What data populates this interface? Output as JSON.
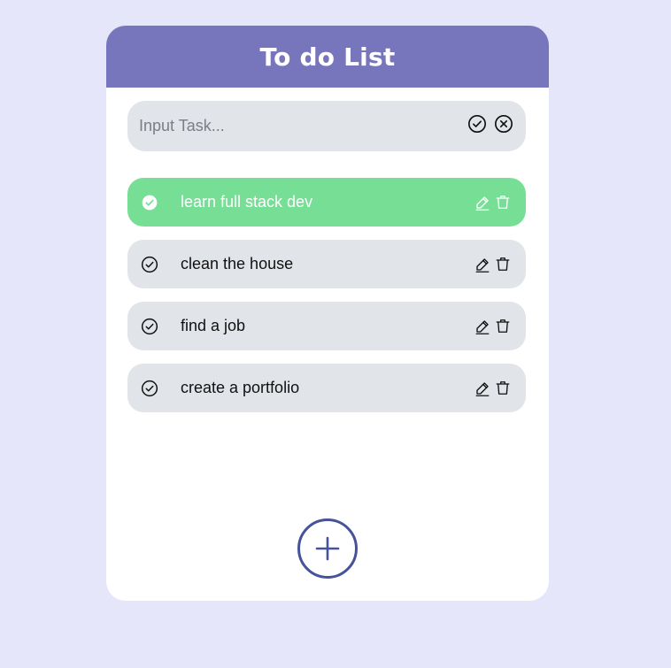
{
  "header": {
    "title": "To do List"
  },
  "input": {
    "placeholder": "Input Task...",
    "value": "",
    "confirm_icon": "check-circle-icon",
    "cancel_icon": "x-circle-icon"
  },
  "tasks": [
    {
      "text": "learn full stack dev",
      "completed": true
    },
    {
      "text": "clean the house",
      "completed": false
    },
    {
      "text": "find a job",
      "completed": false
    },
    {
      "text": "create a portfolio",
      "completed": false
    }
  ],
  "task_icons": {
    "check": "check-circle-icon",
    "edit": "pencil-icon",
    "delete": "trash-icon"
  },
  "add_button": {
    "icon": "plus-icon"
  },
  "colors": {
    "page_background": "#e6e6fa",
    "header": "#7776bc",
    "card": "#ffffff",
    "task_default": "#e1e4e8",
    "task_done": "#77df95",
    "add_button": "#45539a"
  }
}
